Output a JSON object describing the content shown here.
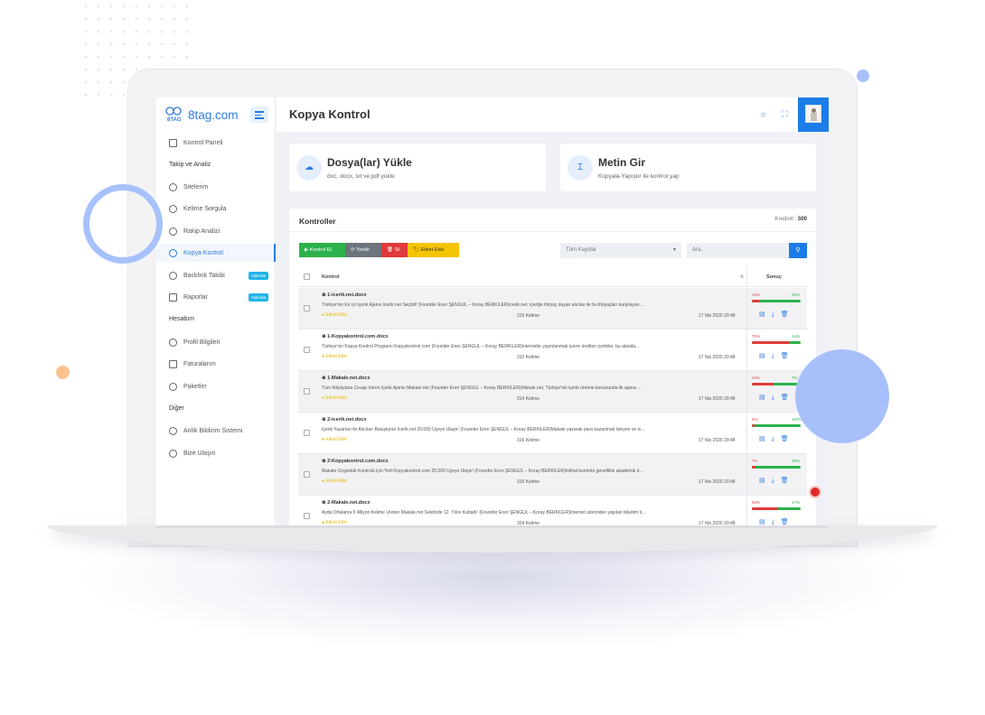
{
  "logo": {
    "mark": "8TAG",
    "text": "8tag.com"
  },
  "sidebar": {
    "items": [
      {
        "label": "Kontrol Paneli"
      },
      {
        "label": "Sitelerim"
      },
      {
        "label": "Kelime Sorgula"
      },
      {
        "label": "Rakip Analizi"
      },
      {
        "label": "Kopya Kontrol",
        "active": true
      },
      {
        "label": "Backlink Takibi",
        "badge": "Yakında"
      },
      {
        "label": "Raporlar",
        "badge": "Yakında"
      },
      {
        "label": "Profil Bilgileri"
      },
      {
        "label": "Faturalarım"
      },
      {
        "label": "Paketler"
      },
      {
        "label": "Anlık Bildirim Sistemi"
      },
      {
        "label": "Bize Ulaşın"
      }
    ],
    "headings": [
      "Takip ve Analiz",
      "Hesabım",
      "Diğer"
    ]
  },
  "topbar": {
    "title": "Kopya Kontrol",
    "icons": [
      "sun-icon",
      "fullscreen-icon"
    ]
  },
  "cards": [
    {
      "title": "Dosya(lar) Yükle",
      "subtitle": "doc, docx, txt ve pdf yükle",
      "icon": "cloud-upload-icon"
    },
    {
      "title": "Metin Gir",
      "subtitle": "Kopyala-Yapıştır ile kontrol yap",
      "icon": "text-cursor-icon"
    }
  ],
  "panel": {
    "title": "Kontroller",
    "credit_label": "Kredinit :",
    "credit_value": "500",
    "buttons": {
      "check": "▶ Kontrol Et",
      "refresh": "⟳ Yenile",
      "delete": "🗑 Sil",
      "tag": "🏷 Etiket Ekle"
    },
    "colors": {
      "check": "#2bb24c",
      "refresh": "#6c757d",
      "delete": "#e03a3a",
      "tag": "#f5c400"
    },
    "filter": {
      "selected": "Tüm Kayıtlar"
    },
    "search": {
      "placeholder": "Ara.."
    },
    "headers": {
      "control": "Kontrol",
      "result": "Sonuç"
    }
  },
  "rows": [
    {
      "file": "1-icerik.net.docx",
      "desc": "Türkiye'nin En İyi İçerik Ajansı İcerik.net Seçildi! (Founder Eren ŞENGÜL – Koray BERKİLER)icerik.net, içeriğe ihtiyaç duyan alıcılar ile bu ihtiyaçları karşılayan ...",
      "tag": "Etiket Ekle",
      "words": "315 Kelime",
      "date": "17 Nis 2020 20:48",
      "left": "14%",
      "right": "33%",
      "ratio": 0.14
    },
    {
      "file": "1-Kopyakontrol.com.docx",
      "desc": "Türkiye'nin Kopya Kontrol Programı Kopyakontrol.com (Founder Eren ŞENGÜL – Koray BERKİLER)internette yayınlanmak üzere üretilen içerikler, bu alanda...",
      "tag": "Etiket Ekle",
      "words": "310 Kelime",
      "date": "17 Nis 2020 20:48",
      "left": "75%",
      "right": "24%",
      "ratio": 0.75
    },
    {
      "file": "1-Makale.net.docx",
      "desc": "Tüm İhtiyaçlara Cevap Veren İçerik Ajansı Makale.net (Founder Eren ŞENGÜL – Koray BERKİLER)Makale.net, Türkiye'nin içerik üretme konusunda ilk ajansı ...",
      "tag": "Etiket Ekle",
      "words": "314 Kelime",
      "date": "17 Nis 2020 20:48",
      "left": "44%",
      "right": "7%",
      "ratio": 0.44
    },
    {
      "file": "2-icerik.net.docx",
      "desc": "İçerik Yazarları ile Alıcıları Buluşturan İcerik.net 20.000 Üyeye Ulaştı! (Founder Eren ŞENGÜL – Koray BERKİLER)Makale yazarak para kazanmak isteyen ve w...",
      "tag": "Etiket Ekle",
      "words": "316 Kelime",
      "date": "17 Nis 2020 20:48",
      "left": "5%",
      "right": "100%",
      "ratio": 0.05
    },
    {
      "file": "2-Kopyakontrol.com.docx",
      "desc": "Makale Özgünlük Kontrolü İçin Yerli Kopyakontrol.com 25.000 Üyeye Ulaştı! (Founder Eren ŞENGÜL – Koray BERKİLER)İntihal kontrolü genellikle akademik d...",
      "tag": "Etiket Ekle",
      "words": "315 Kelime",
      "date": "17 Nis 2020 20:48",
      "left": "7%",
      "right": "29%",
      "ratio": 0.07
    },
    {
      "file": "2-Makale.net.docx",
      "desc": "Ayda Ortalama 5 Milyon Kelime Üreten Makale.net Sektörde 12. Yılını Kutladı! (Founder Eren ŞENGÜL – Koray BERKİLER)İnternet üzerinden yapılan tüketim ti...",
      "tag": "Etiket Ekle",
      "words": "324 Kelime",
      "date": "17 Nis 2020 20:48",
      "left": "53%",
      "right": "17%",
      "ratio": 0.53
    }
  ]
}
